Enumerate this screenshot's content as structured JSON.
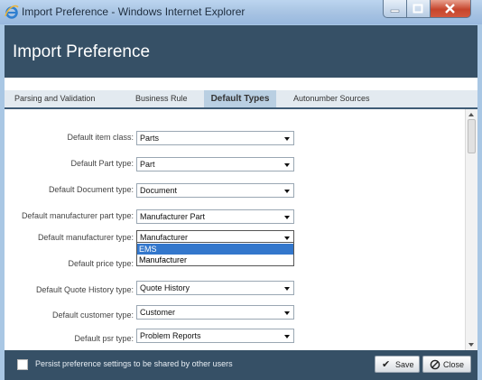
{
  "window": {
    "title": "Import Preference - Windows Internet Explorer"
  },
  "header": {
    "title": "Import Preference"
  },
  "tabs": [
    {
      "label": "Parsing and Validation",
      "active": false
    },
    {
      "label": "Business Rule",
      "active": false
    },
    {
      "label": "Default Types",
      "active": true
    },
    {
      "label": "Autonumber Sources",
      "active": false
    }
  ],
  "fields": [
    {
      "label": "Default item class:",
      "value": "Parts"
    },
    {
      "label": "Default Part type:",
      "value": "Part"
    },
    {
      "label": "Default Document type:",
      "value": "Document"
    },
    {
      "label": "Default manufacturer part type:",
      "value": "Manufacturer Part"
    },
    {
      "label": "Default manufacturer type:",
      "value": "Manufacturer"
    },
    {
      "label": "Default price type:",
      "value": ""
    },
    {
      "label": "Default Quote History type:",
      "value": "Quote History"
    },
    {
      "label": "Default customer type:",
      "value": "Customer"
    },
    {
      "label": "Default psr type:",
      "value": "Problem Reports"
    }
  ],
  "dropdown": {
    "options": [
      "EMS",
      "Manufacturer"
    ],
    "highlighted": "EMS"
  },
  "footer": {
    "persist_label": "Persist preference settings to be shared by other users",
    "save_label": "Save",
    "close_label": "Close",
    "save_icon": "checkmark-icon",
    "close_icon": "no-sign-icon"
  },
  "colors": {
    "header": "#365066",
    "active_tab": "#b9cfe2",
    "highlight": "#3377cc"
  }
}
